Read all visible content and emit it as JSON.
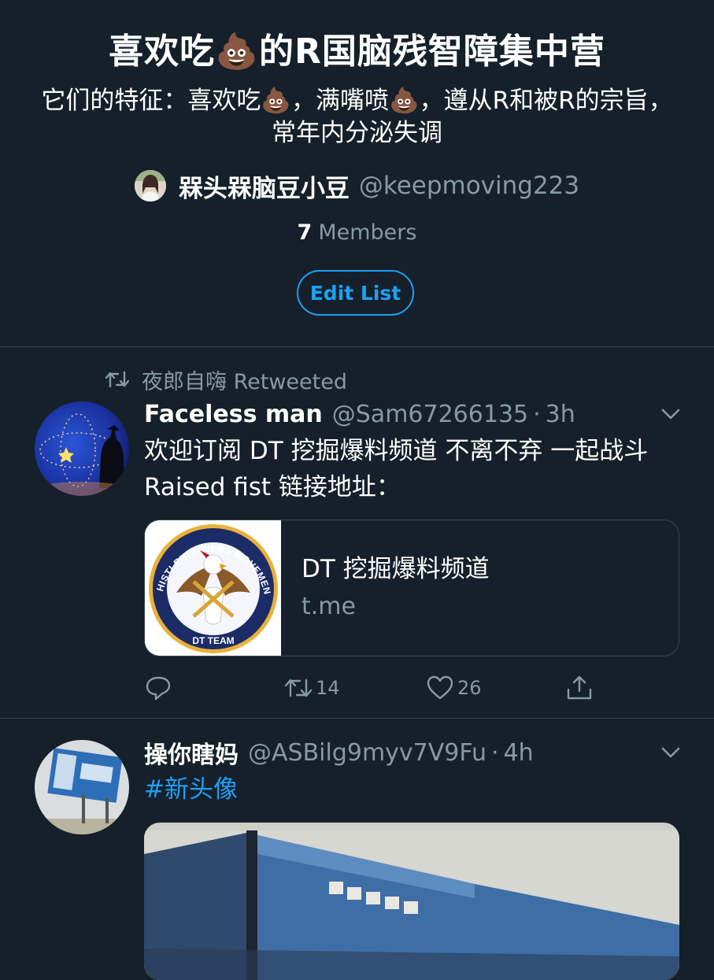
{
  "list": {
    "title": "喜欢吃💩的R国脑残智障集中营",
    "description": "它们的特征：喜欢吃💩，满嘴喷💩，遵从R和被R的宗旨，常年内分泌失调",
    "owner_name": "槑头槑脑豆小豆",
    "owner_handle": "@keepmoving223",
    "members_count": "7",
    "members_label": "Members",
    "edit_button": "Edit List"
  },
  "tweets": [
    {
      "retweeted_by": "夜郎自嗨 Retweeted",
      "name": "Faceless man",
      "handle": "@Sam67266135",
      "dot": "·",
      "time": "3h",
      "text": "欢迎订阅 DT 挖掘爆料频道  不离不弃 一起战斗 Raised fist 链接地址：",
      "card": {
        "title": "DT 挖掘爆料频道",
        "domain": "t.me",
        "logo_top_text": "WHISTLEBLOWERS MOVEMENT",
        "logo_bottom_text": "DT TEAM"
      },
      "actions": {
        "retweets": "14",
        "likes": "26"
      }
    },
    {
      "name": "操你瞎妈",
      "handle": "@ASBilg9myv7V9Fu",
      "dot": "·",
      "time": "4h",
      "hashtag": "#新头像"
    }
  ],
  "colors": {
    "background": "#15202b",
    "accent": "#1da1f2",
    "secondary_text": "#8899a6",
    "border": "#38444d"
  },
  "icons": [
    "retweet-icon",
    "caret-down-icon",
    "reply-icon",
    "retweet-icon",
    "like-icon",
    "share-icon"
  ]
}
